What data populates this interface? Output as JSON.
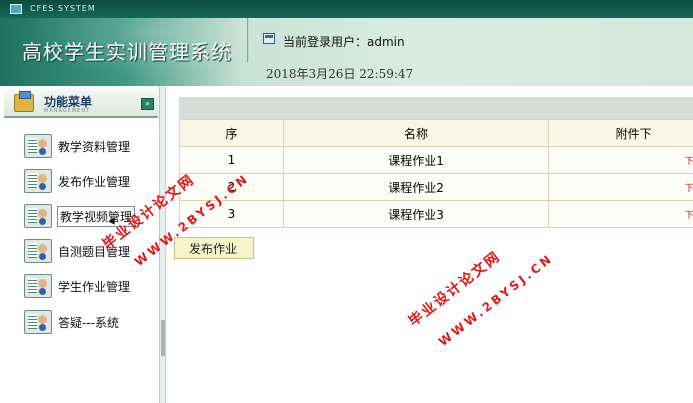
{
  "system": {
    "label": "CFES SYSTEM"
  },
  "header": {
    "app_title": "高校学生实训管理系统",
    "current_user": "当前登录用户：admin",
    "datetime": "2018年3月26日   22:59:47"
  },
  "sidebar": {
    "title": "功能菜单",
    "subtitle": "MANAGEMENT",
    "collapse_icon": "double-chevron-down-icon",
    "items": [
      {
        "label": "教学资料管理",
        "icon": "student-card-icon"
      },
      {
        "label": "发布作业管理",
        "icon": "student-card-icon"
      },
      {
        "label": "教学视频管理",
        "icon": "student-card-icon"
      },
      {
        "label": "自测题目管理",
        "icon": "student-card-icon"
      },
      {
        "label": "学生作业管理",
        "icon": "student-card-icon"
      },
      {
        "label": "答疑---系统",
        "icon": "student-card-icon"
      }
    ]
  },
  "table": {
    "headers": [
      "序",
      "名称",
      "附件下"
    ],
    "rows": [
      {
        "index": "1",
        "name": "课程作业1",
        "download": "下载"
      },
      {
        "index": "2",
        "name": "课程作业2",
        "download": "下载"
      },
      {
        "index": "3",
        "name": "课程作业3",
        "download": "下载"
      }
    ]
  },
  "actions": {
    "publish_label": "发布作业"
  },
  "watermark": {
    "text_cn": "毕业设计论文网",
    "text_url": "WWW.2BYSJ.CN"
  },
  "colors": {
    "header_green": "#1f7262",
    "link_red": "#c81010",
    "button_yellow": "#f6f4c8"
  }
}
